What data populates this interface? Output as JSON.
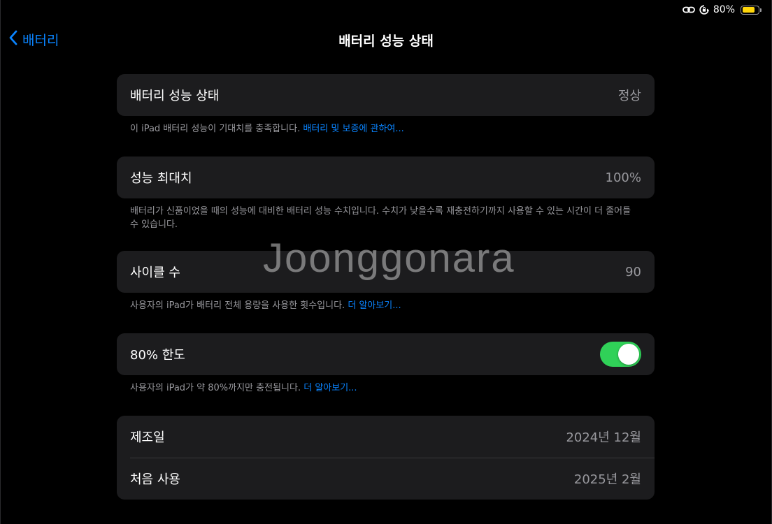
{
  "status_bar": {
    "battery_percent_text": "80%",
    "battery_level": 0.8,
    "battery_color": "#ffd60a",
    "icons": [
      "link-icon",
      "orientation-lock-icon",
      "battery-icon"
    ]
  },
  "nav": {
    "back_label": "배터리",
    "back_icon": "chevron-left-icon",
    "title": "배터리 성능 상태"
  },
  "sections": {
    "health": {
      "label": "배터리 성능 상태",
      "value": "정상",
      "footer_text": "이 iPad 배터리 성능이 기대치를 충족합니다.",
      "footer_link": "배터리 및 보증에 관하여..."
    },
    "max_capacity": {
      "label": "성능 최대치",
      "value": "100%",
      "footer_text": "배터리가 신품이었을 때의 성능에 대비한 배터리 성능 수치입니다. 수치가 낮을수록 재충전하기까지 사용할 수 있는 시간이 더 줄어들 수 있습니다."
    },
    "cycle_count": {
      "label": "사이클 수",
      "value": "90",
      "footer_text": "사용자의 iPad가 배터리 전체 용량을 사용한 횟수입니다.",
      "footer_link": "더 알아보기..."
    },
    "limit_80": {
      "label": "80% 한도",
      "toggle_on": true,
      "toggle_color": "#30d158",
      "footer_text": "사용자의 iPad가 약 80%까지만 충전됩니다.",
      "footer_link": "더 알아보기..."
    },
    "dates": {
      "manufactured_label": "제조일",
      "manufactured_value": "2024년 12월",
      "first_use_label": "처음 사용",
      "first_use_value": "2025년 2월"
    }
  },
  "watermark": "Joonggonara",
  "colors": {
    "accent": "#0a84ff",
    "background": "#000000",
    "card": "#1c1c1e",
    "secondary_text": "#98989d"
  }
}
